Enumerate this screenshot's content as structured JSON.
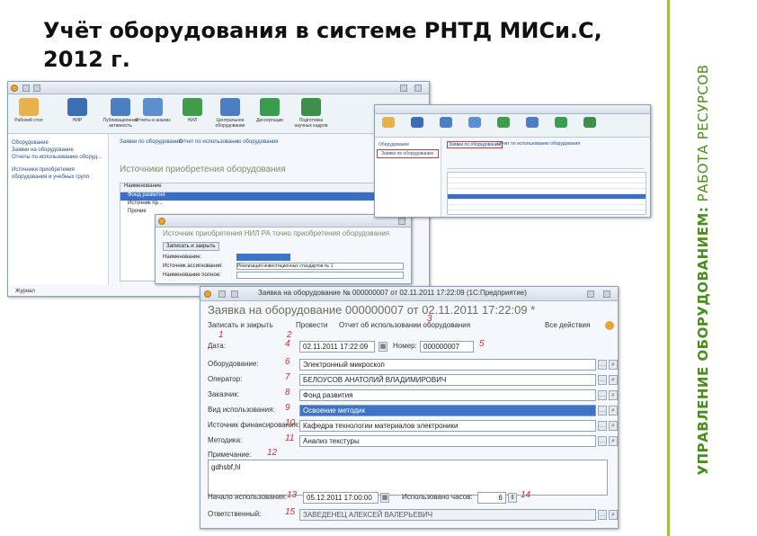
{
  "slide": {
    "title": "Учёт оборудования в системе РНТД МИСи.С, 2012 г.",
    "side_bold": "УПРАВЛЕНИЕ ОБОРУДОВАНИЕМ:",
    "side_normal": " РАБОТА РЕСУРСОВ",
    "accent": "#9bc13c"
  },
  "win1": {
    "ribbon": [
      "Рабочий стол",
      "НИР",
      "Публикационная активность",
      "Отчеты и анализ",
      "НИЛ",
      "Центральное оборудование",
      "Диссертации",
      "Подготовка научных кадров"
    ],
    "nav": [
      "Оборудование",
      "Заявки на оборудование",
      "Отчеты по использованию оборуд..."
    ],
    "nav_extra": "Источники приобретения оборудования и учебных групп",
    "tabs": [
      "Заявки по оборудованию",
      "Отчет по использованию оборудования"
    ],
    "heading": "Источники приобретения оборудования",
    "group_header": "Наименование",
    "tree": [
      "Фонд развития",
      "Источник пр...",
      "Прочие"
    ],
    "subform_heading": "Источник приобретения НИЛ РА точно приобретения оборудования",
    "subform_btn": "Записать и закрыть",
    "subform_labels": [
      "Наименование:",
      "Источник ассигнования:",
      "Наименование полное:"
    ],
    "subform_values": [
      "",
      "Реализация инвестиционных стандартов № 1",
      ""
    ],
    "status": "Журнал"
  },
  "win2": {
    "nav": [
      "Оборудование",
      "Заявки по оборудованию"
    ],
    "tabs": [
      "Заявки по оборудованию",
      "Отчет по использованию оборудования"
    ],
    "rows": 12
  },
  "form": {
    "window_title": "Заявка на оборудование № 000000007 от 02.11.2011 17:22:09 (1С:Предприятие)",
    "heading": "Заявка на оборудование 000000007 от 02.11.2011 17:22:09 *",
    "toolbar": [
      "Записать и закрыть",
      "Провести",
      "Отчет об использовании оборудования",
      "Все действия"
    ],
    "fields": [
      {
        "label": "Дата:",
        "num": "4",
        "value": "02.11.2011 17:22:09"
      },
      {
        "label": "Оборудование:",
        "num": "6",
        "value": "Электронный микроскоп"
      },
      {
        "label": "Оператор:",
        "num": "7",
        "value": "БЕЛОУСОВ АНАТОЛИЙ ВЛАДИМИРОВИЧ"
      },
      {
        "label": "Заказчик:",
        "num": "8",
        "value": "Фонд развития"
      },
      {
        "label": "Вид использования:",
        "num": "9",
        "value": "Освоение методик"
      },
      {
        "label": "Источник финансирования:",
        "num": "10",
        "value": "Кафедра технологии материалов электроники"
      },
      {
        "label": "Методика:",
        "num": "11",
        "value": "Анализ текстуры"
      }
    ],
    "number_label": "Номер:",
    "number_num": "5",
    "number_value": "000000007",
    "note_label": "Примечание:",
    "note_num": "12",
    "note_value": "gdhsbf,hl",
    "start_label": "Начало использования:",
    "start_num": "13",
    "start_value": "05.12.2011 17:00:00",
    "hours_label": "Использовано часов:",
    "hours_num": "14",
    "hours_value": "6",
    "author_label": "Ответственный:",
    "author_num": "15",
    "author_value": "ЗАВЕДЕНЕЦ АЛЕКСЕЙ ВАЛЕРЬЕВИЧ",
    "annot_1": "1",
    "annot_2": "2",
    "annot_3": "3"
  }
}
